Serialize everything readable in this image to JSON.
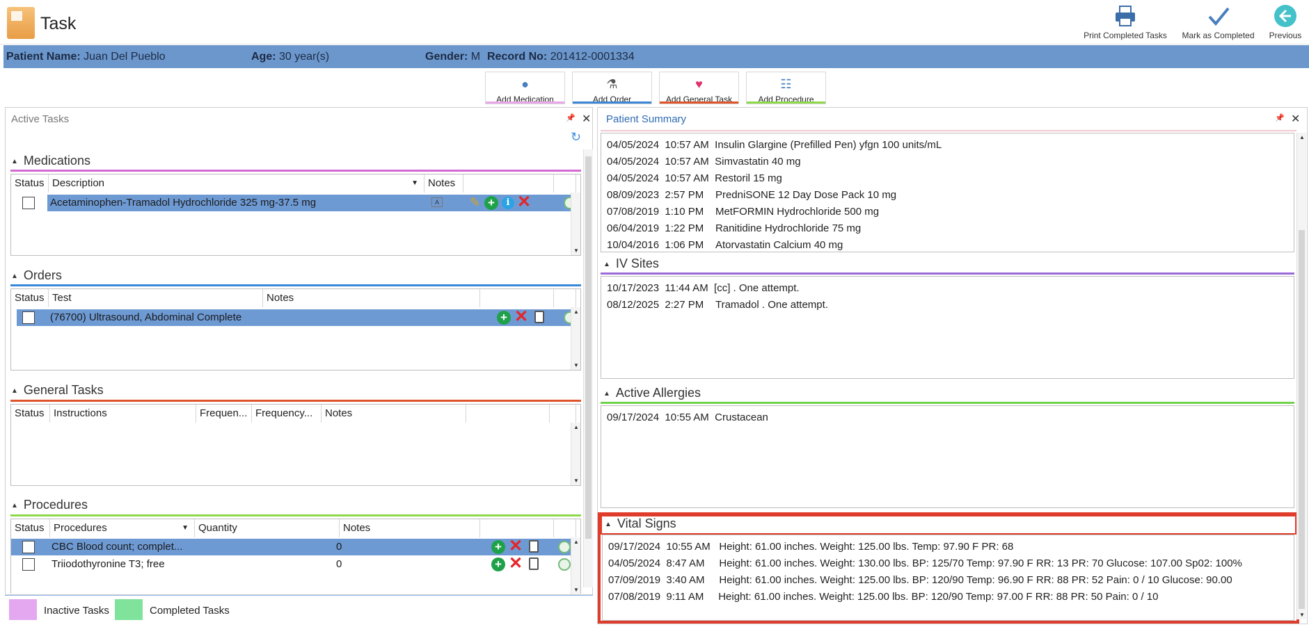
{
  "app": {
    "title": "Task"
  },
  "toolbar": {
    "print_label": "Print Completed Tasks",
    "mark_label": "Mark as Completed",
    "previous_label": "Previous"
  },
  "patient": {
    "name_key": "Patient Name:",
    "name": "Juan Del Pueblo",
    "age_key": "Age:",
    "age": "30 year(s)",
    "gender_key": "Gender:",
    "gender": "M",
    "record_key": "Record No:",
    "record": "201412-0001334"
  },
  "add_buttons": {
    "medication": "Add Medication",
    "order": "Add Order",
    "general_task": "Add General Task",
    "procedure": "Add Procedure"
  },
  "active_tasks": {
    "title": "Active Tasks",
    "medications": {
      "title": "Medications",
      "columns": [
        "Status",
        "Description",
        "Notes"
      ],
      "rows": [
        {
          "description": "Acetaminophen-Tramadol Hydrochloride 325 mg-37.5 mg"
        }
      ]
    },
    "orders": {
      "title": "Orders",
      "columns": [
        "Status",
        "Test",
        "Notes"
      ],
      "rows": [
        {
          "test": "(76700) Ultrasound, Abdominal Complete"
        }
      ]
    },
    "general_tasks": {
      "title": "General Tasks",
      "columns": [
        "Status",
        "Instructions",
        "Frequen...",
        "Frequency...",
        "Notes"
      ]
    },
    "procedures": {
      "title": "Procedures",
      "columns": [
        "Status",
        "Procedures",
        "Quantity",
        "Notes"
      ],
      "rows": [
        {
          "name": "CBC Blood count; complet...",
          "quantity": "0"
        },
        {
          "name": "Triiodothyronine T3; free",
          "quantity": "0"
        }
      ]
    }
  },
  "legend": {
    "inactive": "Inactive Tasks",
    "completed": "Completed Tasks"
  },
  "patient_summary": {
    "title": "Patient Summary",
    "medications": [
      {
        "date": "04/05/2024",
        "time": "10:57 AM",
        "name": "Insulin Glargine (Prefilled Pen)",
        "dose": "yfgn 100 units/mL"
      },
      {
        "date": "04/05/2024",
        "time": "10:57 AM",
        "name": "Simvastatin",
        "dose": "40 mg"
      },
      {
        "date": "04/05/2024",
        "time": "10:57 AM",
        "name": "Restoril",
        "dose": "15 mg"
      },
      {
        "date": "08/09/2023",
        "time": "2:57 PM",
        "name": "PredniSONE 12 Day Dose Pack",
        "dose": "10 mg"
      },
      {
        "date": "07/08/2019",
        "time": "1:10 PM",
        "name": "MetFORMIN Hydrochloride",
        "dose": "500 mg"
      },
      {
        "date": "06/04/2019",
        "time": "1:22 PM",
        "name": "Ranitidine Hydrochloride",
        "dose": "75 mg"
      },
      {
        "date": "10/04/2016",
        "time": "1:06 PM",
        "name": "Atorvastatin Calcium",
        "dose": "40 mg"
      }
    ],
    "iv_sites": {
      "title": "IV Sites",
      "items": [
        {
          "date": "10/17/2023",
          "time": "11:44 AM",
          "text": "[cc] . One attempt."
        },
        {
          "date": "08/12/2025",
          "time": "2:27 PM",
          "text": "Tramadol . One attempt."
        }
      ]
    },
    "allergies": {
      "title": "Active Allergies",
      "items": [
        {
          "date": "09/17/2024",
          "time": "10:55 AM",
          "text": "Crustacean"
        }
      ]
    },
    "vitals": {
      "title": "Vital Signs",
      "items": [
        {
          "date": "09/17/2024",
          "time": "10:55 AM",
          "text": "Height: 61.00 inches. Weight: 125.00 lbs. Temp: 97.90 F PR: 68"
        },
        {
          "date": "04/05/2024",
          "time": "8:47 AM",
          "text": "Height: 61.00 inches. Weight: 130.00 lbs. BP: 125/70 Temp: 97.90 F RR: 13 PR: 70 Glucose: 107.00 Sp02: 100%"
        },
        {
          "date": "07/09/2019",
          "time": "3:40 AM",
          "text": "Height: 61.00 inches. Weight: 125.00 lbs. BP: 120/90 Temp: 96.90 F RR: 88 PR: 52 Pain: 0 / 10 Glucose: 90.00"
        },
        {
          "date": "07/08/2019",
          "time": "9:11 AM",
          "text": "Height: 61.00 inches. Weight: 125.00 lbs. BP: 120/90 Temp: 97.00 F RR: 88 PR: 50 Pain: 0 / 10"
        }
      ]
    }
  },
  "colors": {
    "patient_bar": "#6c97cc",
    "selected_row": "#6e9ad4",
    "medications_line": "#d46ad4",
    "orders_line": "#3a86d8",
    "general_line": "#e0542a",
    "procedures_line": "#8ed94a",
    "iv_line": "#9a6ad8",
    "allergies_line": "#6fd34a",
    "highlight": "#e03c2c",
    "inactive": "#e3a8f0",
    "completed": "#7fe39b"
  }
}
